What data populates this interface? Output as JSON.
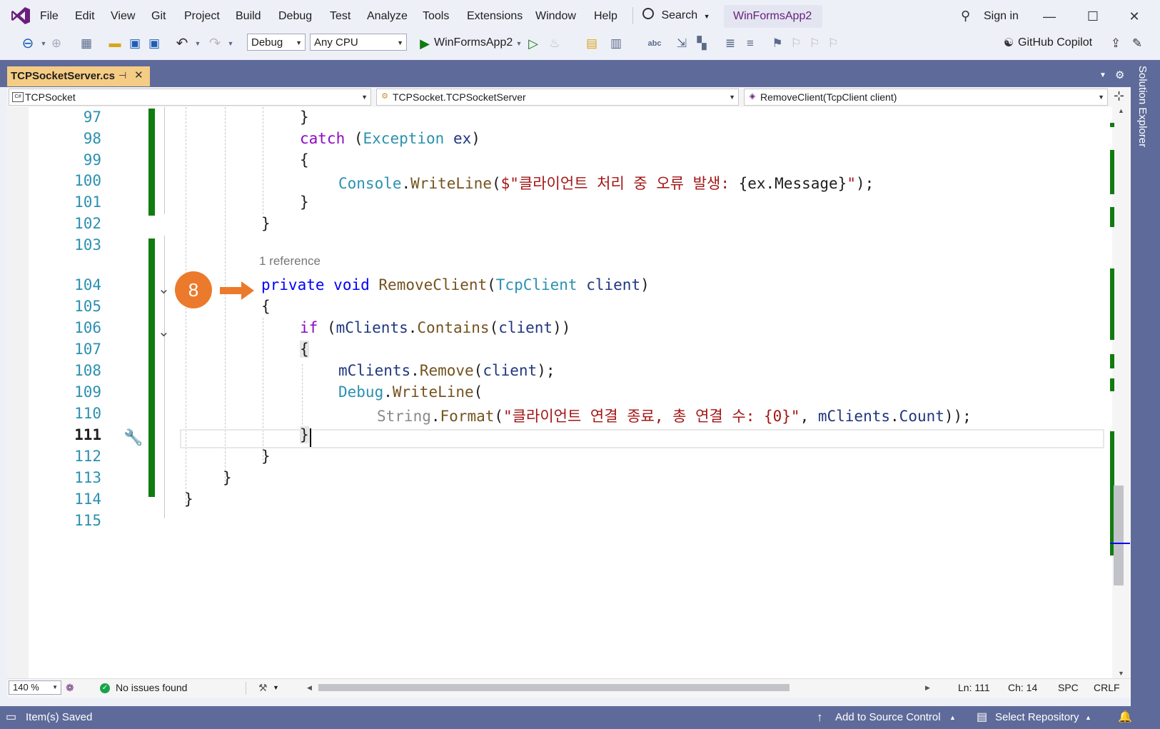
{
  "menu": {
    "items": [
      "File",
      "Edit",
      "View",
      "Git",
      "Project",
      "Build",
      "Debug",
      "Test",
      "Analyze",
      "Tools",
      "Extensions",
      "Window",
      "Help"
    ],
    "search_label": "Search",
    "app_title": "WinFormsApp2",
    "sign_in": "Sign in"
  },
  "toolbar": {
    "config": "Debug",
    "platform": "Any CPU",
    "start_target": "WinFormsApp2",
    "copilot": "GitHub Copilot"
  },
  "tabs": {
    "active": "TCPSocketServer.cs",
    "side_panel": "Solution Explorer"
  },
  "navbar": {
    "project": "TCPSocket",
    "type": "TCPSocket.TCPSocketServer",
    "member": "RemoveClient(TcpClient client)"
  },
  "editor": {
    "line_numbers": [
      "97",
      "98",
      "99",
      "100",
      "101",
      "102",
      "103",
      "104",
      "105",
      "106",
      "107",
      "108",
      "109",
      "110",
      "111",
      "112",
      "113",
      "114",
      "115"
    ],
    "reference_lens": "1 reference",
    "annotation_badge": "8",
    "code": {
      "l97": "}",
      "l98_kw": "catch",
      "l98_type": "Exception",
      "l98_var": "ex",
      "l99": "{",
      "l100_type": "Console",
      "l100_method": "WriteLine",
      "l100_str1": "$\"클라이언트 처리 중 오류 발생: ",
      "l100_interp": "{ex.Message}",
      "l100_str2": "\"",
      "l101": "}",
      "l102": "}",
      "l104_kw1": "private",
      "l104_kw2": "void",
      "l104_method": "RemoveClient",
      "l104_type": "TcpClient",
      "l104_param": "client",
      "l105": "{",
      "l106_kw": "if",
      "l106_field": "mClients",
      "l106_method": "Contains",
      "l106_param": "client",
      "l107": "{",
      "l108_field": "mClients",
      "l108_method": "Remove",
      "l108_param": "client",
      "l109_type": "Debug",
      "l109_method": "WriteLine",
      "l110_type": "String",
      "l110_method": "Format",
      "l110_str": "\"클라이언트 연결 종료, 총 연결 수: {0}\"",
      "l110_field": "mClients",
      "l110_prop": "Count",
      "l111": "}",
      "l112": "}",
      "l113": "}",
      "l114": "}"
    }
  },
  "editor_status": {
    "zoom": "140 %",
    "issues": "No issues found",
    "line": "Ln: 111",
    "col": "Ch: 14",
    "whitespace": "SPC",
    "line_ending": "CRLF"
  },
  "statusbar": {
    "message": "Item(s) Saved",
    "source_control": "Add to Source Control",
    "repository": "Select Repository"
  },
  "colors": {
    "accent": "#68217a",
    "tab_active": "#f5cc84",
    "chrome": "#5e6b9a",
    "change_bar": "#107c10",
    "badge": "#ec7a2c"
  }
}
